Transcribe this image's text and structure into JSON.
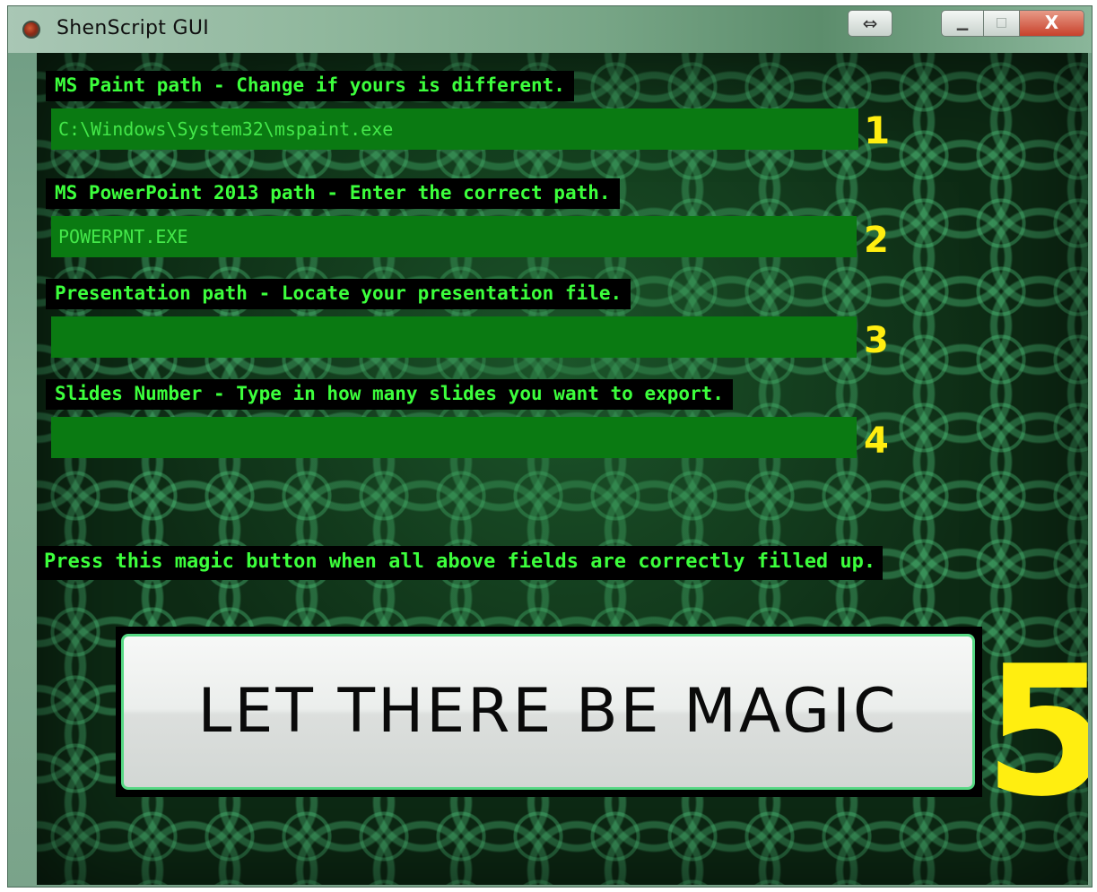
{
  "window": {
    "title": "ShenScript GUI",
    "controls": {
      "resize_glyph": "⇔",
      "minimize_glyph": "▁",
      "maximize_glyph": "□",
      "close_glyph": "X"
    }
  },
  "form": {
    "fields": [
      {
        "label": "MS Paint path - Change if yours is different.",
        "value": "C:\\Windows\\System32\\mspaint.exe",
        "number": "1"
      },
      {
        "label": "MS PowerPoint 2013 path - Enter the correct path.",
        "value": "POWERPNT.EXE",
        "number": "2"
      },
      {
        "label": "Presentation path - Locate your presentation file.",
        "value": "",
        "number": "3"
      },
      {
        "label": "Slides Number - Type in how many slides you want to export.",
        "value": "",
        "number": "4"
      }
    ],
    "instruction": "Press this magic button when all above fields are correctly filled up.",
    "button_label": "LET THERE BE MAGIC",
    "button_number": "5"
  },
  "colors": {
    "label_text": "#3cff3c",
    "field_bg": "#0a7a12",
    "number": "#ffee10"
  },
  "icons": {
    "app": "app-icon",
    "resize": "resize-icon"
  }
}
